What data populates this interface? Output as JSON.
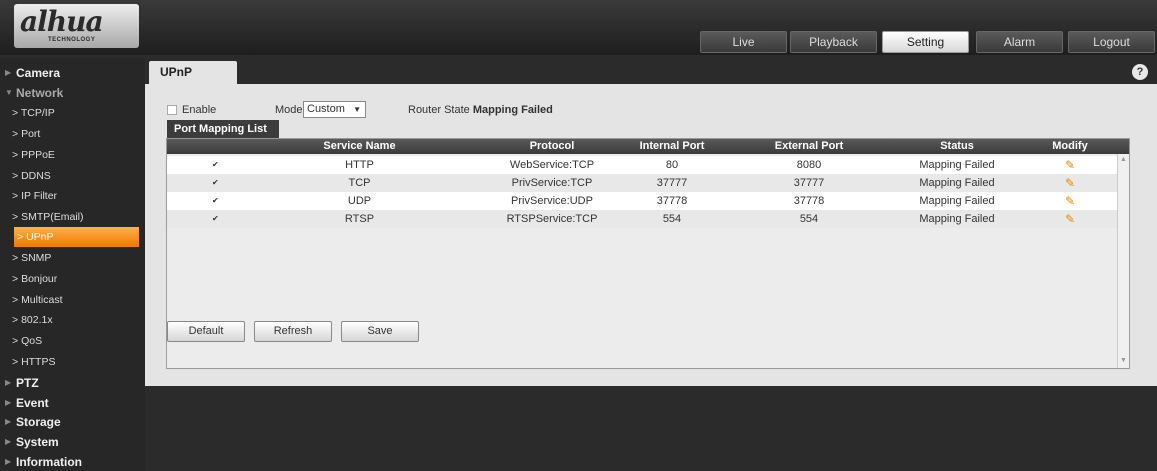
{
  "logo": {
    "text": "alhua",
    "sub": "TECHNOLOGY"
  },
  "top_tabs": [
    {
      "label": "Live",
      "active": false
    },
    {
      "label": "Playback",
      "active": false
    },
    {
      "label": "Setting",
      "active": true
    },
    {
      "label": "Alarm",
      "active": false
    },
    {
      "label": "Logout",
      "active": false
    }
  ],
  "sidebar": {
    "camera": "Camera",
    "network": "Network",
    "network_items": [
      "TCP/IP",
      "Port",
      "PPPoE",
      "DDNS",
      "IP Filter",
      "SMTP(Email)",
      "UPnP",
      "SNMP",
      "Bonjour",
      "Multicast",
      "802.1x",
      "QoS",
      "HTTPS"
    ],
    "active_item": "UPnP",
    "after": [
      "PTZ",
      "Event",
      "Storage",
      "System",
      "Information"
    ]
  },
  "page": {
    "tab": "UPnP",
    "help": "?",
    "enable_label": "Enable",
    "enable_checked": false,
    "mode_label": "Mode",
    "mode_value": "Custom",
    "router_state_label": "Router State",
    "router_state_value": "Mapping Failed",
    "list_tab": "Port Mapping List"
  },
  "table": {
    "headers": [
      "Service Name",
      "Protocol",
      "Internal Port",
      "External Port",
      "Status",
      "Modify"
    ],
    "rows": [
      {
        "checked": true,
        "service": "HTTP",
        "protocol": "WebService:TCP",
        "internal": "80",
        "external": "8080",
        "status": "Mapping Failed"
      },
      {
        "checked": true,
        "service": "TCP",
        "protocol": "PrivService:TCP",
        "internal": "37777",
        "external": "37777",
        "status": "Mapping Failed"
      },
      {
        "checked": true,
        "service": "UDP",
        "protocol": "PrivService:UDP",
        "internal": "37778",
        "external": "37778",
        "status": "Mapping Failed"
      },
      {
        "checked": true,
        "service": "RTSP",
        "protocol": "RTSPService:TCP",
        "internal": "554",
        "external": "554",
        "status": "Mapping Failed"
      }
    ]
  },
  "buttons": {
    "default": "Default",
    "refresh": "Refresh",
    "save": "Save"
  },
  "colors": {
    "accent": "#f07800",
    "header_bg": "#2b2b2b",
    "panel_bg": "#e4e4e4",
    "edit_icon": "#e88a00"
  }
}
